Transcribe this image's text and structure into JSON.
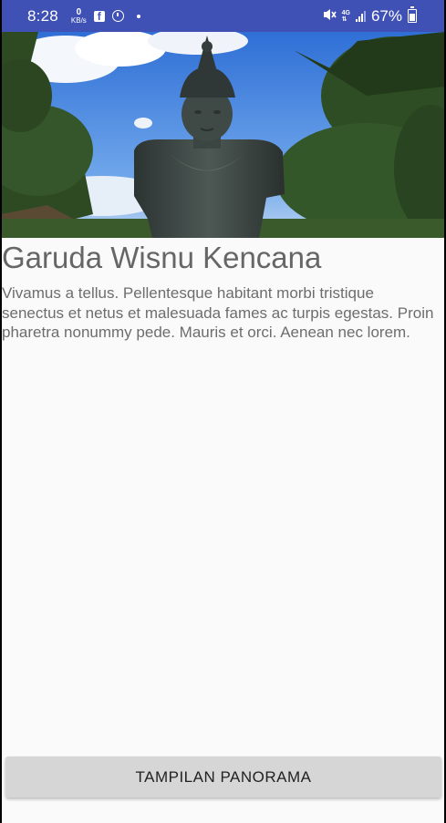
{
  "status_bar": {
    "time": "8:28",
    "kbs_value": "0",
    "kbs_unit": "KB/s",
    "network_type": "4G",
    "battery_percent": "67%",
    "icons": [
      "kbs-icon",
      "facebook-icon",
      "alarm-icon",
      "dot-icon",
      "mute-icon",
      "network-4g-icon",
      "signal-icon",
      "battery-icon"
    ]
  },
  "hero": {
    "image_name": "statue-photo"
  },
  "place": {
    "title": "Garuda Wisnu Kencana",
    "description": "Vivamus a tellus. Pellentesque habitant morbi tristique senectus et netus et malesuada fames ac turpis egestas. Proin pharetra nonummy pede. Mauris et orci. Aenean nec lorem."
  },
  "actions": {
    "panorama_label": "TAMPILAN PANORAMA"
  },
  "colors": {
    "status_bar": "#3f51b5",
    "background": "#fafafa",
    "button": "#d6d6d6",
    "title_text": "#666666"
  }
}
